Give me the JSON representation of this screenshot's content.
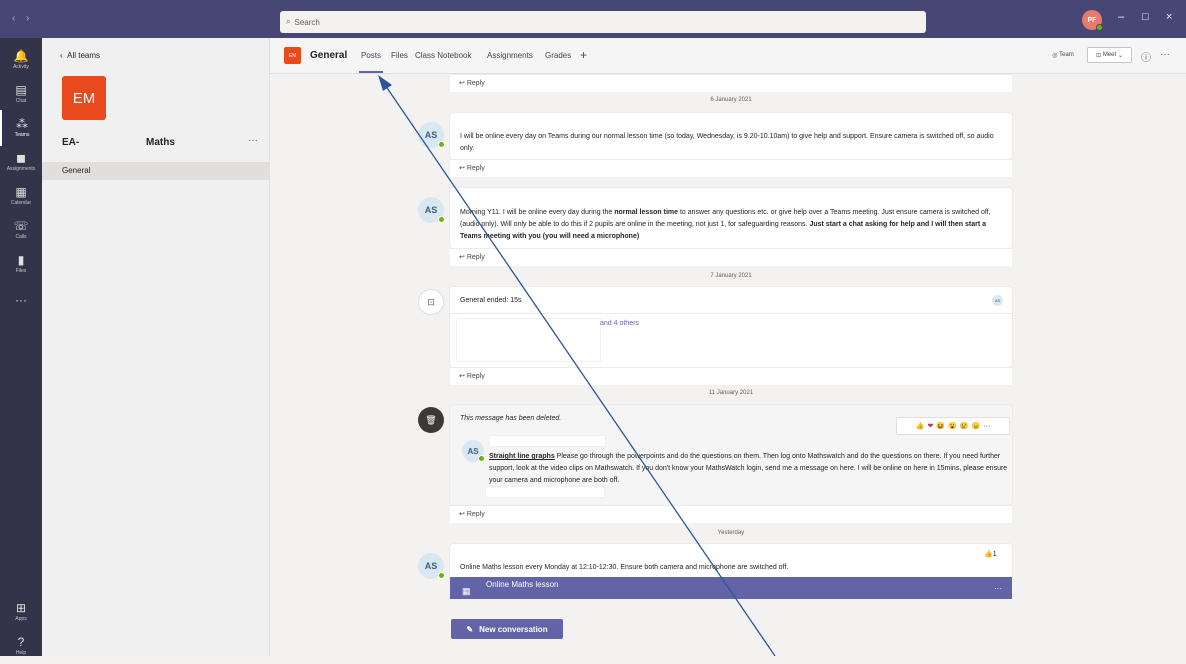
{
  "titlebar": {
    "search_placeholder": "Search",
    "avatar_initials": "PF",
    "back_arrow": "‹",
    "forward_arrow": "›",
    "minimize": "–",
    "maximize": "□",
    "close": "×"
  },
  "rail": [
    {
      "label": "Activity",
      "icon": "bell-icon",
      "glyph": "🔔"
    },
    {
      "label": "Chat",
      "icon": "chat-icon",
      "glyph": "▤"
    },
    {
      "label": "Teams",
      "icon": "teams-icon",
      "glyph": "⁂"
    },
    {
      "label": "Assignments",
      "icon": "assignments-icon",
      "glyph": "◼"
    },
    {
      "label": "Calendar",
      "icon": "calendar-icon",
      "glyph": "▦"
    },
    {
      "label": "Calls",
      "icon": "phone-icon",
      "glyph": "☏"
    },
    {
      "label": "Files",
      "icon": "files-icon",
      "glyph": "▮"
    },
    {
      "label": "",
      "icon": "more-icon",
      "glyph": "···"
    },
    {
      "label": "Apps",
      "icon": "apps-icon",
      "glyph": "⊞"
    },
    {
      "label": "Help",
      "icon": "help-icon",
      "glyph": "?"
    }
  ],
  "teams_pane": {
    "back_label": "All teams",
    "team_initials": "EM",
    "team_name_left": "EA-",
    "team_name_right": "Maths",
    "more": "···",
    "channel": "General"
  },
  "header": {
    "initials": "EM",
    "title": "General",
    "tabs": [
      "Posts",
      "Files",
      "Class Notebook",
      "Assignments",
      "Grades",
      "+"
    ],
    "team_btn": "Team",
    "meet_btn": "Meet",
    "info": "ⓘ",
    "more": "···"
  },
  "feed": {
    "reply": "Reply",
    "date1": "6 January 2021",
    "msg1": "I will be online every day on Teams during our normal lesson time (so today, Wednesday, is 9.20-10.10am) to give help and support. Ensure camera is switched off, so audio only.",
    "msg2_a": "Morning Y11. I will be online every day during the ",
    "msg2_b": "normal lesson time",
    "msg2_c": " to answer any questions etc. or give help over a Teams meeting. Just ensure camera is switched off, (audio only). Will only be able to do this if 2 pupils are online in the meeting, not just 1, for safeguarding reasons. ",
    "msg2_d": "Just start a chat asking for help and I will then start a Teams meeting with you (you will need a microphone)",
    "date2": "7 January 2021",
    "meeting_ended": "General ended: 15s",
    "and_others": "and 4 others",
    "mini_avatar": "AS",
    "date3": "11 January 2021",
    "deleted": "This message has been deleted.",
    "msg3_title": "Straight line graphs",
    "msg3_body": "  Please go through the powerpoints and do the questions on them. Then log onto Mathswatch and do the questions on there. If you need further support, look at the video clips on Mathswatch. If you don't know your MathsWatch login, send me a message on here. I will be online on here in 15mins, please ensure your camera and microphone are both off.",
    "reactions": [
      "👍",
      "❤",
      "😆",
      "😮",
      "😢",
      "😠",
      "···"
    ],
    "date4": "Yesterday",
    "like_count": "1",
    "msg4": "Online Maths lesson every Monday at 12:10-12:30. Ensure both camera and microphone are switched off.",
    "meeting_title": "Online Maths lesson",
    "avatar": "AS",
    "new_conversation": "New conversation"
  }
}
